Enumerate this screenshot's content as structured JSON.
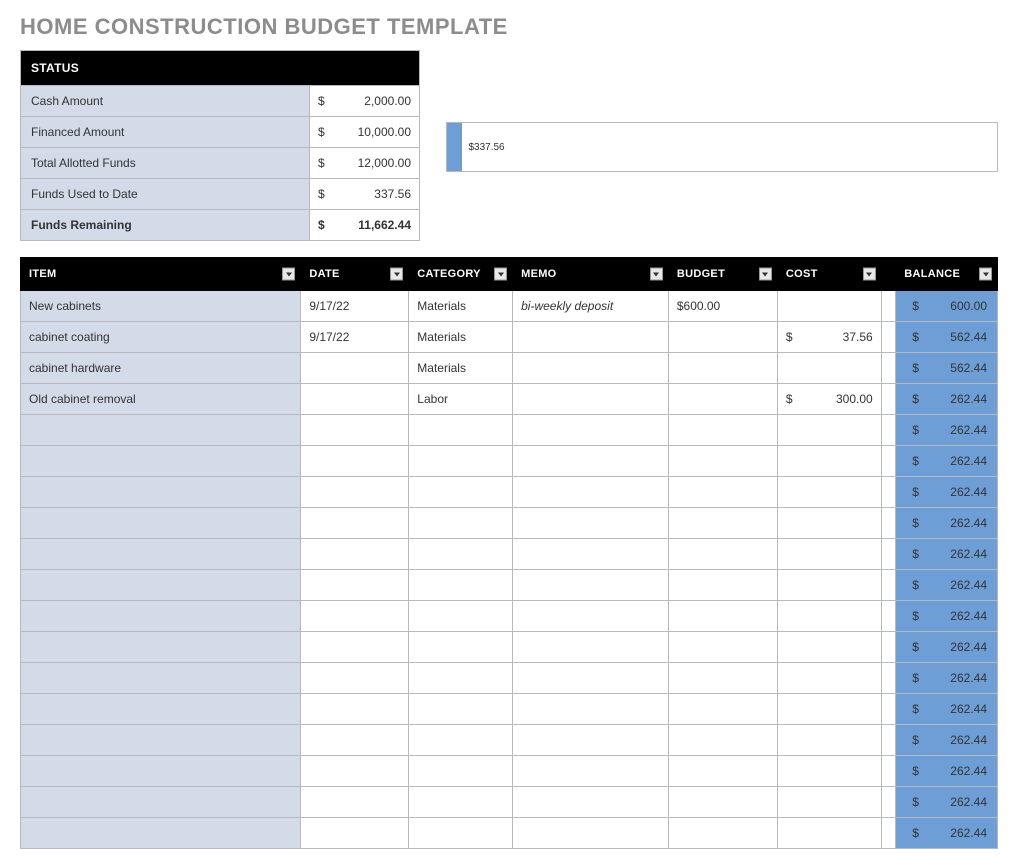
{
  "title": "HOME CONSTRUCTION BUDGET TEMPLATE",
  "status": {
    "header": "STATUS",
    "rows": [
      {
        "label": "Cash Amount",
        "value": "2,000.00",
        "bold": false
      },
      {
        "label": "Financed Amount",
        "value": "10,000.00",
        "bold": false
      },
      {
        "label": "Total Allotted Funds",
        "value": "12,000.00",
        "bold": false
      },
      {
        "label": "Funds Used to Date",
        "value": "337.56",
        "bold": false
      },
      {
        "label": "Funds Remaining",
        "value": "11,662.44",
        "bold": true
      }
    ]
  },
  "chart_data": {
    "type": "bar",
    "orientation": "horizontal",
    "categories": [
      "Funds Used to Date"
    ],
    "values": [
      337.56
    ],
    "xlim": [
      0,
      12000
    ],
    "data_label": "$337.56",
    "title": "",
    "xlabel": "",
    "ylabel": ""
  },
  "items": {
    "headers": {
      "item": "ITEM",
      "date": "DATE",
      "category": "CATEGORY",
      "memo": "MEMO",
      "budget": "BUDGET",
      "cost": "COST",
      "balance": "BALANCE"
    },
    "rows": [
      {
        "item": "New cabinets",
        "date": "9/17/22",
        "category": "Materials",
        "memo": "bi-weekly deposit",
        "budget": "$600.00",
        "cost": "",
        "balance": "600.00"
      },
      {
        "item": "cabinet coating",
        "date": "9/17/22",
        "category": "Materials",
        "memo": "",
        "budget": "",
        "cost": "37.56",
        "balance": "562.44"
      },
      {
        "item": "cabinet hardware",
        "date": "",
        "category": "Materials",
        "memo": "",
        "budget": "",
        "cost": "",
        "balance": "562.44"
      },
      {
        "item": "Old cabinet removal",
        "date": "",
        "category": "Labor",
        "memo": "",
        "budget": "",
        "cost": "300.00",
        "balance": "262.44"
      },
      {
        "item": "",
        "date": "",
        "category": "",
        "memo": "",
        "budget": "",
        "cost": "",
        "balance": "262.44"
      },
      {
        "item": "",
        "date": "",
        "category": "",
        "memo": "",
        "budget": "",
        "cost": "",
        "balance": "262.44"
      },
      {
        "item": "",
        "date": "",
        "category": "",
        "memo": "",
        "budget": "",
        "cost": "",
        "balance": "262.44"
      },
      {
        "item": "",
        "date": "",
        "category": "",
        "memo": "",
        "budget": "",
        "cost": "",
        "balance": "262.44"
      },
      {
        "item": "",
        "date": "",
        "category": "",
        "memo": "",
        "budget": "",
        "cost": "",
        "balance": "262.44"
      },
      {
        "item": "",
        "date": "",
        "category": "",
        "memo": "",
        "budget": "",
        "cost": "",
        "balance": "262.44"
      },
      {
        "item": "",
        "date": "",
        "category": "",
        "memo": "",
        "budget": "",
        "cost": "",
        "balance": "262.44"
      },
      {
        "item": "",
        "date": "",
        "category": "",
        "memo": "",
        "budget": "",
        "cost": "",
        "balance": "262.44"
      },
      {
        "item": "",
        "date": "",
        "category": "",
        "memo": "",
        "budget": "",
        "cost": "",
        "balance": "262.44"
      },
      {
        "item": "",
        "date": "",
        "category": "",
        "memo": "",
        "budget": "",
        "cost": "",
        "balance": "262.44"
      },
      {
        "item": "",
        "date": "",
        "category": "",
        "memo": "",
        "budget": "",
        "cost": "",
        "balance": "262.44"
      },
      {
        "item": "",
        "date": "",
        "category": "",
        "memo": "",
        "budget": "",
        "cost": "",
        "balance": "262.44"
      },
      {
        "item": "",
        "date": "",
        "category": "",
        "memo": "",
        "budget": "",
        "cost": "",
        "balance": "262.44"
      },
      {
        "item": "",
        "date": "",
        "category": "",
        "memo": "",
        "budget": "",
        "cost": "",
        "balance": "262.44"
      }
    ]
  },
  "currency": "$"
}
